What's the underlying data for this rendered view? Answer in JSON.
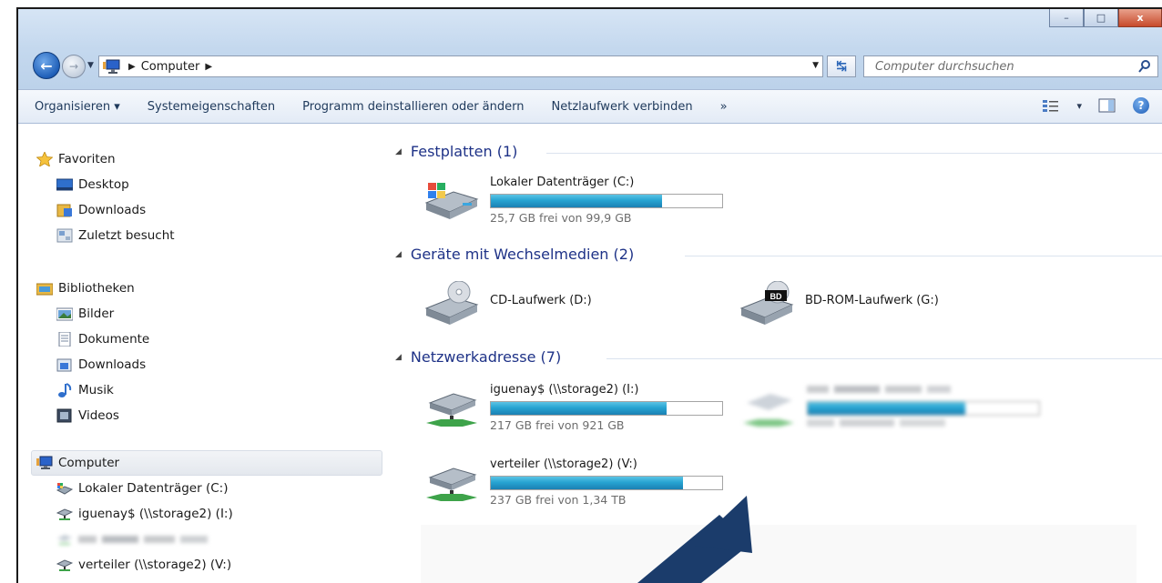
{
  "window": {
    "controls": {
      "minimize": "–",
      "maximize": "□",
      "close": "x"
    }
  },
  "address": {
    "crumb": "Computer",
    "search_placeholder": "Computer durchsuchen"
  },
  "toolbar": {
    "organize": "Organisieren ▾",
    "system_properties": "Systemeigenschaften",
    "uninstall": "Programm deinstallieren oder ändern",
    "map_drive": "Netzlaufwerk verbinden",
    "more": "»",
    "view_menu": "▾"
  },
  "sidebar": {
    "favorites": "Favoriten",
    "fav_items": [
      "Desktop",
      "Downloads",
      "Zuletzt besucht"
    ],
    "libraries": "Bibliotheken",
    "lib_items": [
      "Bilder",
      "Dokumente",
      "Downloads",
      "Musik",
      "Videos"
    ],
    "computer": "Computer",
    "computer_items": [
      "Lokaler Datenträger (C:)",
      "iguenay$ (\\\\storage2) (I:)",
      "",
      "verteiler (\\\\storage2) (V:)"
    ]
  },
  "main": {
    "groups": {
      "hdd": "Festplatten (1)",
      "removable": "Geräte mit Wechselmedien (2)",
      "network": "Netzwerkadresse (7)"
    },
    "drives": {
      "c": {
        "name": "Lokaler Datenträger (C:)",
        "free": "25,7 GB frei von 99,9 GB",
        "used_fraction": 0.74
      },
      "d": {
        "name": "CD-Laufwerk (D:)"
      },
      "g": {
        "name": "BD-ROM-Laufwerk (G:)",
        "badge": "BD"
      },
      "i": {
        "name": "iguenay$ (\\\\storage2) (I:)",
        "free": "217 GB frei von 921 GB",
        "used_fraction": 0.76
      },
      "x": {
        "used_fraction": 0.68
      },
      "v": {
        "name": "verteiler (\\\\storage2) (V:)",
        "free": "237 GB frei von 1,34 TB",
        "used_fraction": 0.83
      }
    }
  },
  "colors": {
    "group_header": "#1e3287",
    "bar": "#27a4d2",
    "arrow": "#1b3c6b"
  }
}
